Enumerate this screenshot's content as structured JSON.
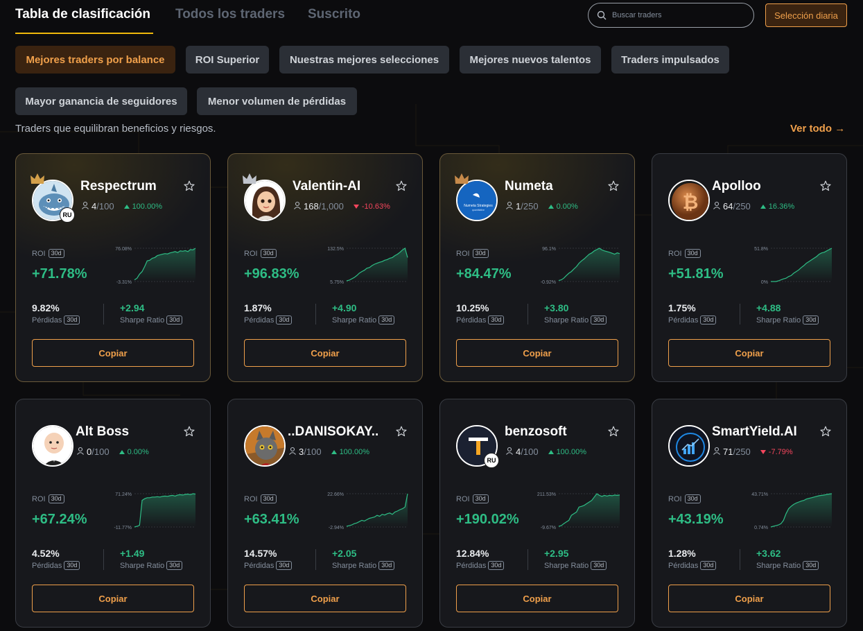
{
  "tabs": {
    "leaderboard": "Tabla de clasificación",
    "all_traders": "Todos los traders",
    "subscribed": "Suscrito"
  },
  "search": {
    "placeholder": "Buscar traders"
  },
  "daily_pick_label": "Selección diaria",
  "filters": [
    "Mejores traders por balance",
    "ROI Superior",
    "Nuestras mejores selecciones",
    "Mejores nuevos talentos",
    "Traders impulsados",
    "Mayor ganancia de seguidores",
    "Menor volumen de pérdidas"
  ],
  "active_filter": "Mejores traders por balance",
  "subtitle": "Traders que equilibran beneficios y riesgos.",
  "see_all": "Ver todo",
  "labels": {
    "roi": "ROI",
    "period": "30d",
    "losses": "Pérdidas",
    "sharpe": "Sharpe Ratio",
    "copy": "Copiar",
    "sep": "/"
  },
  "colors": {
    "accent": "#f0a04b",
    "up": "#2ebd85",
    "down": "#f6465d"
  },
  "traders": [
    {
      "name": "Respectrum",
      "followers": "4",
      "max": "100",
      "change": "100.00%",
      "direction": "up",
      "roi": "+71.78%",
      "chart_max": "76.08%",
      "chart_min": "-3.31%",
      "losses": "9.82%",
      "sharpe": "+2.94",
      "flag": "RU",
      "badge": "crown-gold",
      "avatar": "shark-icon"
    },
    {
      "name": "Valentin-AI",
      "followers": "168",
      "max": "1,000",
      "change": "-10.63%",
      "direction": "down",
      "roi": "+96.83%",
      "chart_max": "132.5%",
      "chart_min": "5.75%",
      "losses": "1.87%",
      "sharpe": "+4.90",
      "flag": "",
      "badge": "crown-silver",
      "avatar": "girl-icon"
    },
    {
      "name": "Numeta",
      "followers": "1",
      "max": "250",
      "change": "0.00%",
      "direction": "up",
      "roi": "+84.47%",
      "chart_max": "96.1%",
      "chart_min": "-0.92%",
      "losses": "10.25%",
      "sharpe": "+3.80",
      "flag": "",
      "badge": "crown-bronze",
      "avatar": "numeta-logo-icon"
    },
    {
      "name": "Apolloo",
      "followers": "64",
      "max": "250",
      "change": "16.36%",
      "direction": "up",
      "roi": "+51.81%",
      "chart_max": "51.8%",
      "chart_min": "0%",
      "losses": "1.75%",
      "sharpe": "+4.88",
      "flag": "",
      "badge": "",
      "avatar": "bitcoin-coin-icon"
    },
    {
      "name": "Alt Boss",
      "followers": "0",
      "max": "100",
      "change": "0.00%",
      "direction": "up",
      "roi": "+67.24%",
      "chart_max": "71.24%",
      "chart_min": "-11.77%",
      "losses": "4.52%",
      "sharpe": "+1.49",
      "flag": "",
      "badge": "",
      "avatar": "baby-boss-icon"
    },
    {
      "name": "..DANISOKAY..",
      "followers": "3",
      "max": "100",
      "change": "100.00%",
      "direction": "up",
      "roi": "+63.41%",
      "chart_max": "22.66%",
      "chart_min": "-2.94%",
      "losses": "14.57%",
      "sharpe": "+2.05",
      "flag": "",
      "badge": "",
      "avatar": "cat-art-icon"
    },
    {
      "name": "benzosoft",
      "followers": "4",
      "max": "100",
      "change": "100.00%",
      "direction": "up",
      "roi": "+190.02%",
      "chart_max": "211.53%",
      "chart_min": "-9.67%",
      "losses": "12.84%",
      "sharpe": "+2.95",
      "flag": "RU",
      "badge": "",
      "avatar": "letter-t-icon"
    },
    {
      "name": "SmartYield.AI",
      "followers": "71",
      "max": "250",
      "change": "-7.79%",
      "direction": "down",
      "roi": "+43.19%",
      "chart_max": "43.71%",
      "chart_min": "0.74%",
      "losses": "1.28%",
      "sharpe": "+3.62",
      "flag": "",
      "badge": "",
      "avatar": "ai-brain-icon"
    }
  ],
  "sparklines": [
    [
      0.05,
      0.1,
      0.22,
      0.3,
      0.45,
      0.62,
      0.64,
      0.7,
      0.72,
      0.78,
      0.8,
      0.82,
      0.84,
      0.83,
      0.86,
      0.88,
      0.9,
      0.87,
      0.92,
      0.91,
      0.93,
      0.9,
      0.96,
      0.95,
      1.0
    ],
    [
      0.02,
      0.04,
      0.08,
      0.12,
      0.18,
      0.25,
      0.3,
      0.34,
      0.4,
      0.42,
      0.48,
      0.52,
      0.55,
      0.58,
      0.6,
      0.64,
      0.66,
      0.7,
      0.72,
      0.78,
      0.82,
      0.88,
      0.95,
      1.0,
      0.72
    ],
    [
      0.03,
      0.05,
      0.1,
      0.18,
      0.25,
      0.3,
      0.38,
      0.45,
      0.55,
      0.62,
      0.68,
      0.75,
      0.82,
      0.86,
      0.92,
      0.96,
      1.0,
      0.95,
      0.92,
      0.9,
      0.88,
      0.85,
      0.82,
      0.86,
      0.84
    ],
    [
      0.0,
      0.0,
      0.0,
      0.02,
      0.05,
      0.08,
      0.1,
      0.15,
      0.18,
      0.25,
      0.3,
      0.35,
      0.42,
      0.48,
      0.55,
      0.6,
      0.65,
      0.7,
      0.75,
      0.82,
      0.86,
      0.88,
      0.92,
      0.96,
      1.0
    ],
    [
      0.0,
      0.02,
      0.05,
      0.8,
      0.85,
      0.88,
      0.88,
      0.9,
      0.9,
      0.91,
      0.9,
      0.92,
      0.93,
      0.92,
      0.94,
      0.95,
      0.93,
      0.96,
      0.97,
      0.96,
      0.98,
      0.99,
      0.97,
      1.0,
      0.99
    ],
    [
      0.02,
      0.04,
      0.06,
      0.1,
      0.12,
      0.16,
      0.2,
      0.18,
      0.22,
      0.26,
      0.28,
      0.3,
      0.35,
      0.32,
      0.38,
      0.36,
      0.4,
      0.42,
      0.38,
      0.45,
      0.48,
      0.52,
      0.55,
      0.6,
      1.0
    ],
    [
      0.02,
      0.04,
      0.1,
      0.15,
      0.2,
      0.35,
      0.4,
      0.45,
      0.6,
      0.62,
      0.65,
      0.7,
      0.75,
      0.8,
      0.9,
      1.0,
      0.95,
      0.92,
      0.95,
      0.93,
      0.95,
      0.94,
      0.96,
      0.95,
      0.96
    ],
    [
      0.0,
      0.02,
      0.04,
      0.06,
      0.1,
      0.2,
      0.4,
      0.55,
      0.62,
      0.68,
      0.72,
      0.75,
      0.78,
      0.8,
      0.84,
      0.86,
      0.88,
      0.9,
      0.92,
      0.94,
      0.95,
      0.96,
      0.98,
      0.99,
      1.0
    ]
  ]
}
